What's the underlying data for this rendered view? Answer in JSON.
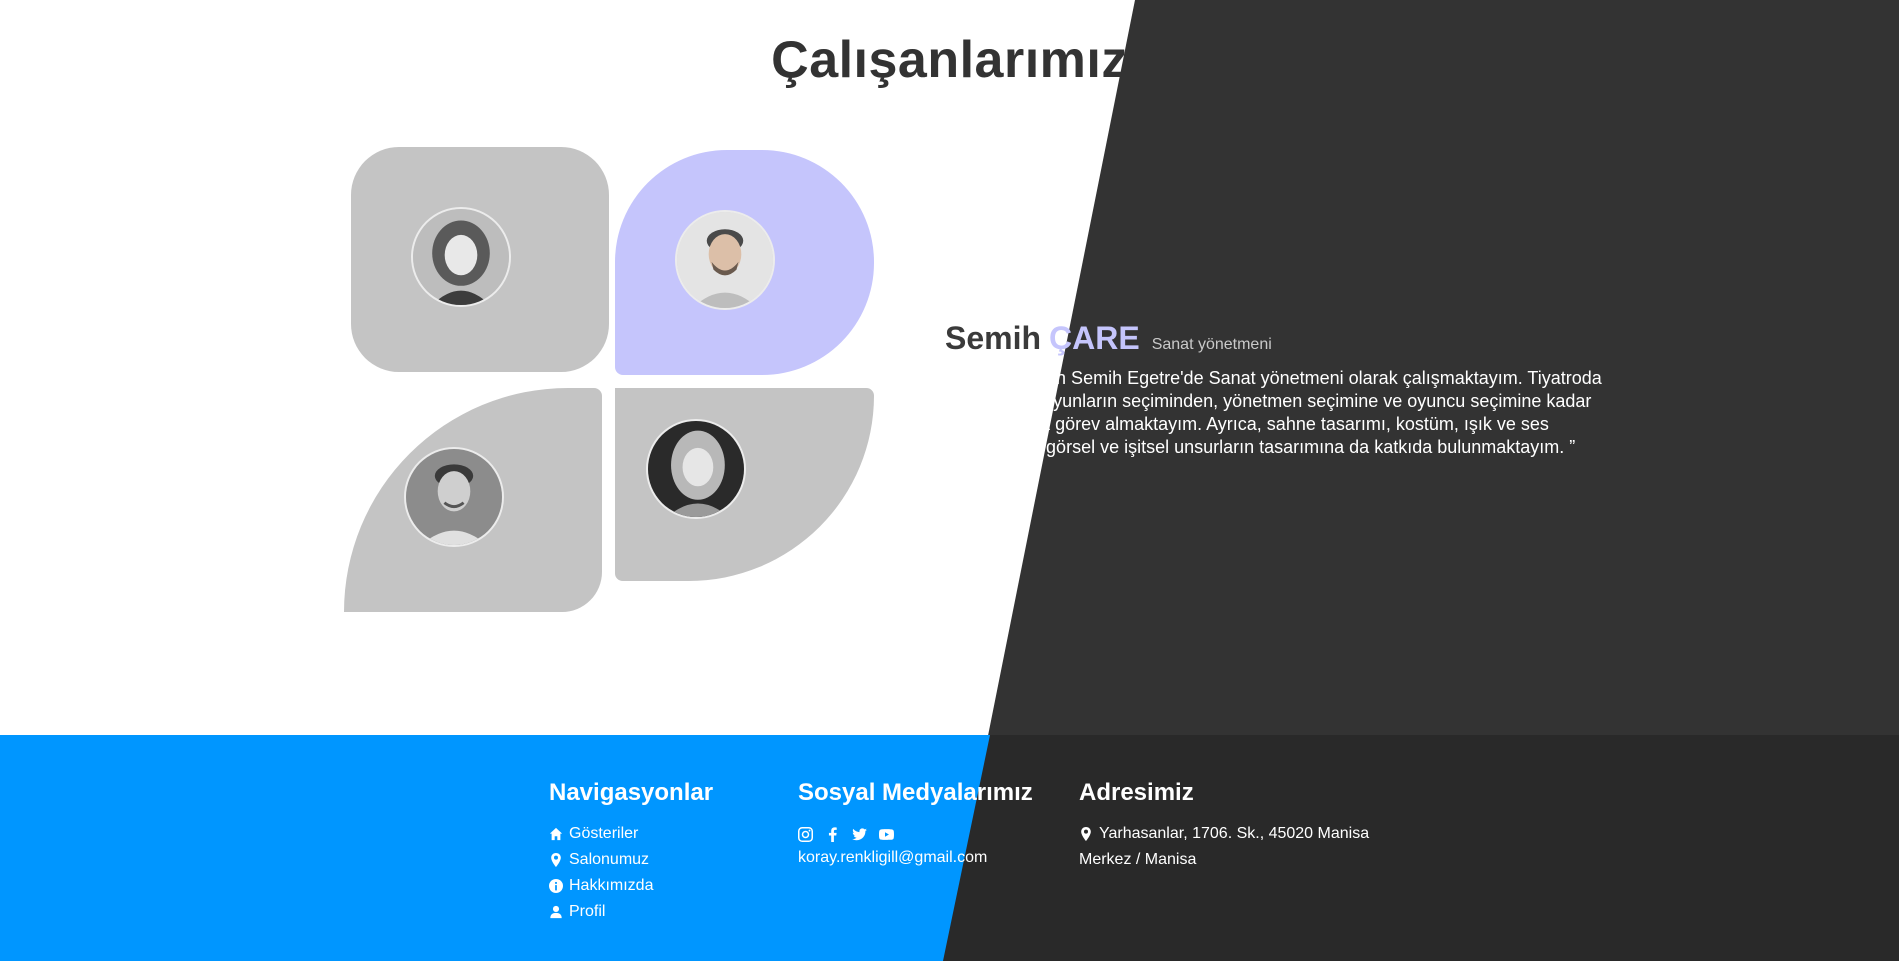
{
  "page": {
    "title": "Çalışanlarımız"
  },
  "team": [
    {
      "id": "member-1",
      "active": false
    },
    {
      "id": "member-2",
      "active": true
    },
    {
      "id": "member-3",
      "active": false
    },
    {
      "id": "member-4",
      "active": false
    }
  ],
  "profile": {
    "first_name": "Semih",
    "last_name": "ÇARE",
    "role": "Sanat yönetmeni",
    "quote": "“ Selamlar, ben Semih Egetre'de Sanat yönetmeni olarak çalışmaktayım. Tiyatroda sahnelenen oyunların seçiminden, yönetmen seçimine ve oyuncu seçimine kadar her aşamada görev almaktayım. Ayrıca, sahne tasarımı, kostüm, ışık ve ses efektleri gibi görsel ve işitsel unsurların tasarımına da katkıda bulunmaktayım. ”"
  },
  "footer": {
    "nav": {
      "heading": "Navigasyonlar",
      "items": [
        {
          "label": "Gösteriler",
          "icon": "home-icon"
        },
        {
          "label": "Salonumuz",
          "icon": "map-pin-icon"
        },
        {
          "label": "Hakkımızda",
          "icon": "info-icon"
        },
        {
          "label": "Profil",
          "icon": "user-icon"
        }
      ]
    },
    "social": {
      "heading": "Sosyal Medyalarımız",
      "icons": [
        "instagram-icon",
        "facebook-icon",
        "twitter-icon",
        "youtube-icon"
      ],
      "email": "koray.renkligill@gmail.com"
    },
    "address": {
      "heading": "Adresimiz",
      "line1": "Yarhasanlar, 1706. Sk., 45020 Manisa",
      "line2": "Merkez / Manisa"
    }
  },
  "colors": {
    "accent": "#c5c5fc",
    "card": "#c4c4c4",
    "dark": "#333333",
    "footer_blue": "#0096ff"
  }
}
